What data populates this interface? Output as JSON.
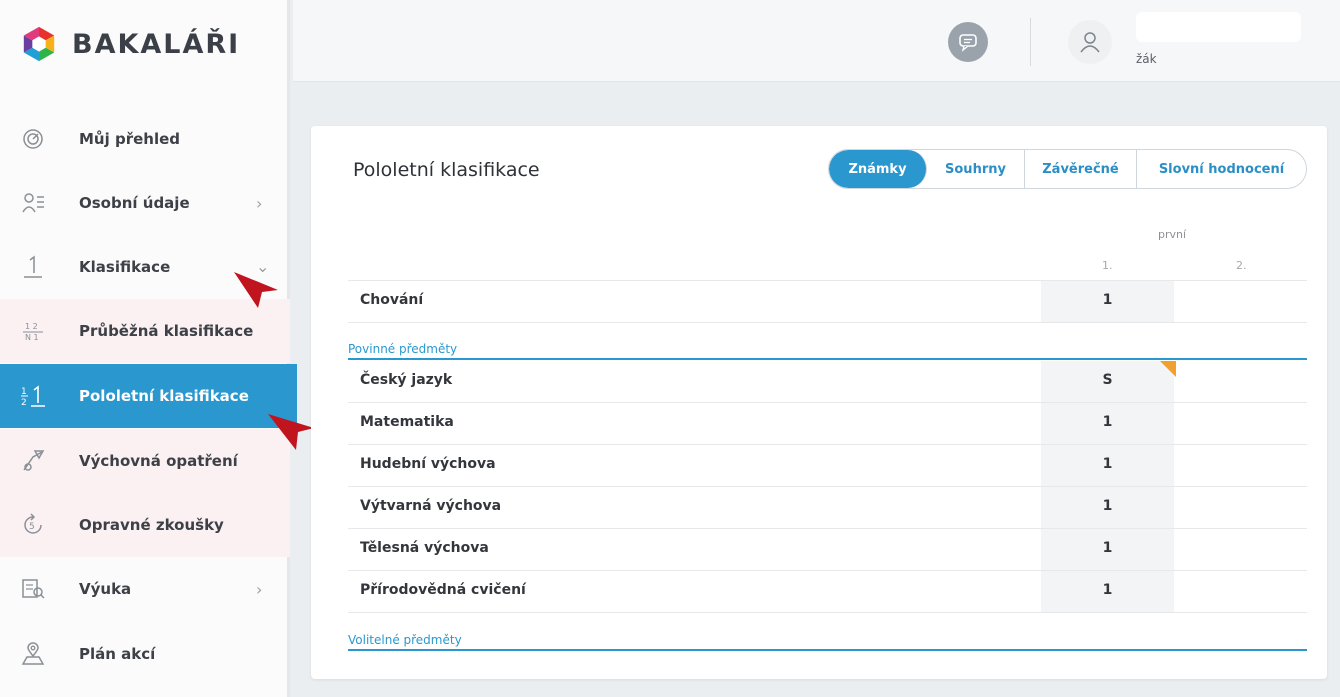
{
  "app": {
    "name": "BAKALÁŘI"
  },
  "sidebar": {
    "items": [
      {
        "label": "Můj přehled",
        "icon": "dashboard-icon"
      },
      {
        "label": "Osobní údaje",
        "icon": "person-card-icon",
        "chevron": "›"
      },
      {
        "label": "Klasifikace",
        "icon": "grade-one-icon",
        "chevron": "⌄"
      },
      {
        "label": "Průběžná klasifikace",
        "icon": "fraction-grades-icon"
      },
      {
        "label": "Pololetní klasifikace",
        "icon": "semester-grades-icon",
        "active": true
      },
      {
        "label": "Výchovná opatření",
        "icon": "pen-award-icon"
      },
      {
        "label": "Opravné zkoušky",
        "icon": "retake-exam-icon"
      },
      {
        "label": "Výuka",
        "icon": "teaching-icon",
        "chevron": "›"
      },
      {
        "label": "Plán akcí",
        "icon": "events-map-icon"
      }
    ]
  },
  "topbar": {
    "user_role": "žák"
  },
  "main": {
    "title": "Pololetní klasifikace",
    "tabs": [
      {
        "label": "Známky",
        "active": true
      },
      {
        "label": "Souhrny"
      },
      {
        "label": "Závěrečné"
      },
      {
        "label": "Slovní hodnocení"
      }
    ],
    "column_group": "první",
    "columns": [
      "1.",
      "2."
    ],
    "rows_top": [
      {
        "subject": "Chování",
        "grade1": "1",
        "grade2": ""
      }
    ],
    "section_required": "Povinné předměty",
    "rows_required": [
      {
        "subject": "Český jazyk",
        "grade1": "S",
        "grade2": ""
      },
      {
        "subject": "Matematika",
        "grade1": "1",
        "grade2": ""
      },
      {
        "subject": "Hudební výchova",
        "grade1": "1",
        "grade2": ""
      },
      {
        "subject": "Výtvarná výchova",
        "grade1": "1",
        "grade2": ""
      },
      {
        "subject": "Tělesná výchova",
        "grade1": "1",
        "grade2": ""
      },
      {
        "subject": "Přírodovědná cvičení",
        "grade1": "1",
        "grade2": ""
      }
    ],
    "section_optional": "Volitelné předměty"
  },
  "colors": {
    "accent": "#2a98cf",
    "annotation_arrow": "#c0141e",
    "note_corner": "#f0a030"
  }
}
